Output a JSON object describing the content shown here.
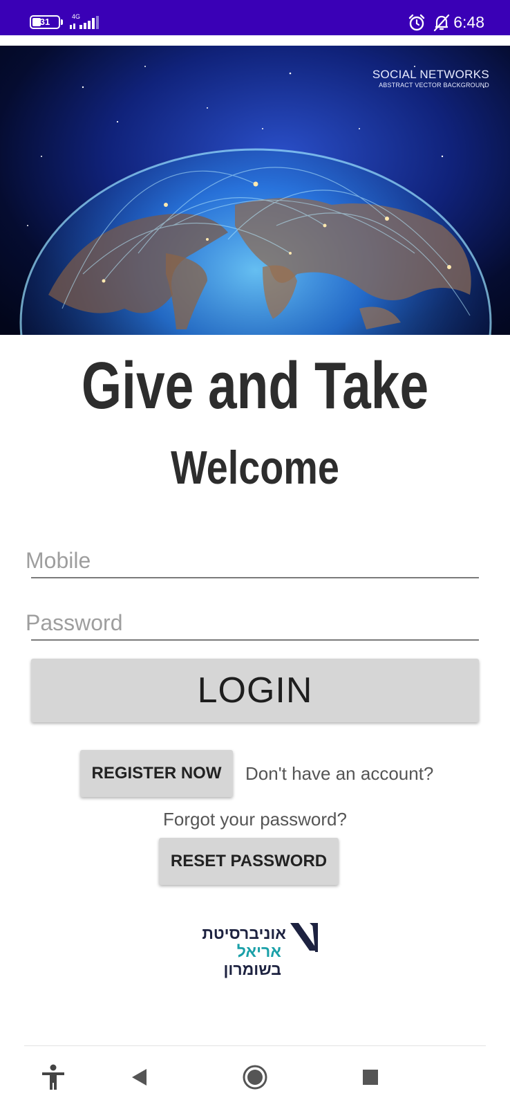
{
  "status_bar": {
    "battery_level": "31",
    "network_type": "4G",
    "time": "6:48",
    "icons": [
      "battery-icon",
      "signal-icon",
      "alarm-icon",
      "notifications-off-icon"
    ],
    "background_color": "#3a00b6"
  },
  "hero": {
    "caption_title": "SOCIAL NETWORKS",
    "caption_subtitle": "ABSTRACT VECTOR BACKGROUND"
  },
  "app": {
    "title": "Give and Take",
    "welcome": "Welcome"
  },
  "login_form": {
    "mobile_placeholder": "Mobile",
    "mobile_value": "",
    "password_placeholder": "Password",
    "password_value": "",
    "login_label": "LOGIN",
    "register_label": "REGISTER NOW",
    "no_account_text": "Don't have an account?",
    "forgot_text": "Forgot your password?",
    "reset_label": "RESET PASSWORD"
  },
  "logo": {
    "line1": "אוניברסיטת",
    "line2": "אריאל",
    "line3": "בשומרון",
    "primary_color": "#1d2240",
    "accent_color": "#1aa0a8"
  },
  "nav_bar": {
    "icons": [
      "accessibility-icon",
      "back-icon",
      "home-icon",
      "recents-icon"
    ]
  }
}
